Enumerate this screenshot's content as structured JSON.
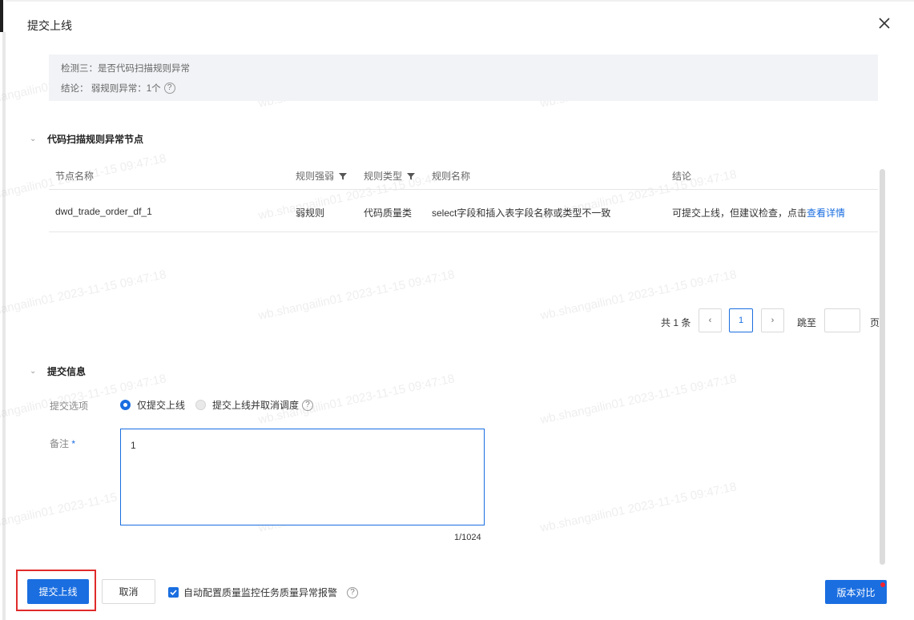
{
  "dialog": {
    "title": "提交上线"
  },
  "check": {
    "line1": "检测三：是否代码扫描规则异常",
    "line2": "结论：  弱规则异常：1个"
  },
  "section1": {
    "title": "代码扫描规则异常节点"
  },
  "table": {
    "headers": [
      "节点名称",
      "规则强弱",
      "规则类型",
      "规则名称",
      "结论"
    ],
    "rows": [
      {
        "node": "dwd_trade_order_df_1",
        "strength": "弱规则",
        "type": "代码质量类",
        "rule": "select字段和插入表字段名称或类型不一致",
        "conclusion": "可提交上线，但建议检查，点击",
        "link": "查看详情"
      }
    ]
  },
  "pagination": {
    "total": "共 1 条",
    "prev": "‹",
    "current": "1",
    "next": "›",
    "jump_label": "跳至",
    "jump_value": "",
    "page_suffix": "页"
  },
  "section2": {
    "title": "提交信息"
  },
  "form": {
    "option_label": "提交选项",
    "option1": "仅提交上线",
    "option2": "提交上线并取消调度",
    "selected": "仅提交上线",
    "remark_label": "备注",
    "remark_required": "*",
    "remark_value": "1",
    "counter": "1/1024"
  },
  "footer": {
    "submit": "提交上线",
    "cancel": "取消",
    "auto_config": "自动配置质量监控任务质量异常报警",
    "auto_config_checked": true,
    "version_compare": "版本对比"
  },
  "watermark": "wb.shangailin01 2023-11-15 09:47:18",
  "colors": {
    "primary": "#1a6ee0",
    "highlight": "#e02a2a",
    "badge": "#f5222d"
  }
}
